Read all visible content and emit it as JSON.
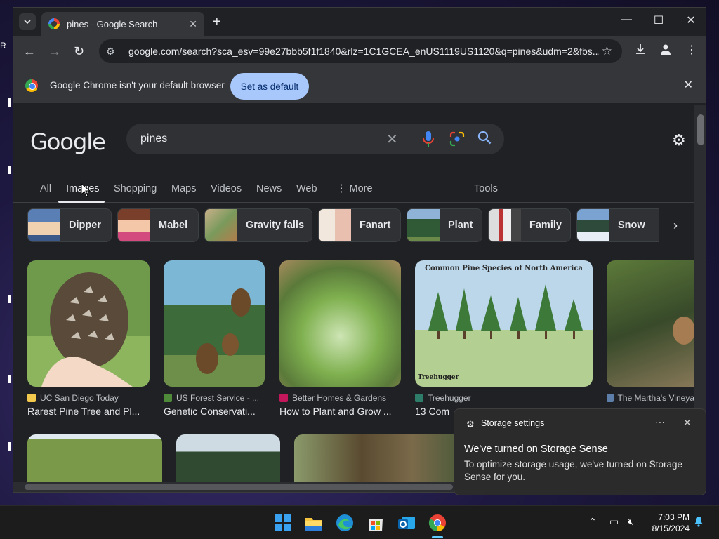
{
  "browser": {
    "tab_title": "pines - Google Search",
    "url": "google.com/search?sca_esv=99e27bbb5f1f1840&rlz=1C1GCEA_enUS1119US1120&q=pines&udm=2&fbs...",
    "infobar_message": "Google Chrome isn't your default browser",
    "set_default_label": "Set as default"
  },
  "google": {
    "logo_text": "Google",
    "query": "pines",
    "tabs": [
      "All",
      "Images",
      "Shopping",
      "Maps",
      "Videos",
      "News",
      "Web",
      "More",
      "Tools"
    ],
    "active_tab": "Images",
    "chips": [
      "Dipper",
      "Mabel",
      "Gravity falls",
      "Fanart",
      "Plant",
      "Family",
      "Snow"
    ],
    "results": [
      {
        "source": "UC San Diego Today",
        "title": "Rarest Pine Tree and Pl..."
      },
      {
        "source": "US Forest Service - ...",
        "title": "Genetic Conservati..."
      },
      {
        "source": "Better Homes & Gardens",
        "title": "How to Plant and Grow ..."
      },
      {
        "source": "Treehugger",
        "title": "13 Com",
        "image_caption": "Common Pine Species of North America",
        "watermark": "Treehugger"
      },
      {
        "source": "The Martha's Vineya",
        "title": ""
      }
    ]
  },
  "notification": {
    "app": "Storage settings",
    "heading": "We've turned on Storage Sense",
    "body": "To optimize storage usage, we've turned on Storage Sense for you."
  },
  "taskbar": {
    "time": "7:03 PM",
    "date": "8/15/2024"
  },
  "colors": {
    "accent_button": "#a8c7fa",
    "link_blue": "#8ab4f8",
    "page_bg": "#202124"
  }
}
